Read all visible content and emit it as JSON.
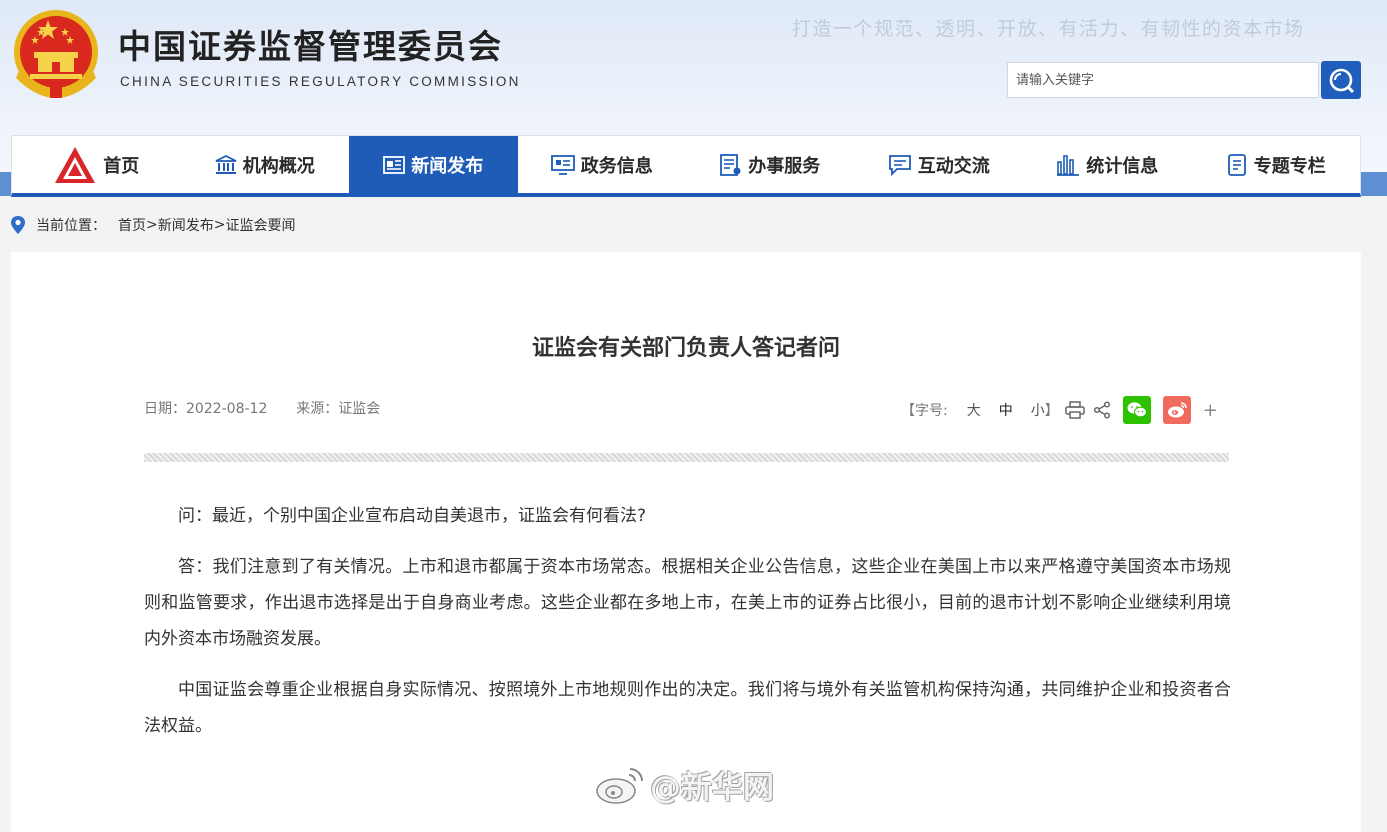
{
  "header": {
    "title_cn": "中国证券监督管理委员会",
    "title_en": "CHINA SECURITIES REGULATORY COMMISSION",
    "slogan": "打造一个规范、透明、开放、有活力、有韧性的资本市场",
    "search_placeholder": "请输入关键字"
  },
  "nav": [
    {
      "label": "首页",
      "icon": "csrc-logo-icon"
    },
    {
      "label": "机构概况",
      "icon": "institution-icon"
    },
    {
      "label": "新闻发布",
      "icon": "news-icon",
      "active": true
    },
    {
      "label": "政务信息",
      "icon": "monitor-icon"
    },
    {
      "label": "办事服务",
      "icon": "service-icon"
    },
    {
      "label": "互动交流",
      "icon": "chat-icon"
    },
    {
      "label": "统计信息",
      "icon": "stats-icon"
    },
    {
      "label": "专题专栏",
      "icon": "topic-icon"
    }
  ],
  "breadcrumb": {
    "prefix": "当前位置：",
    "items": [
      "首页",
      "新闻发布",
      "证监会要闻"
    ],
    "sep": ">"
  },
  "article": {
    "title": "证监会有关部门负责人答记者问",
    "date_label": "日期：",
    "date": "2022-08-12",
    "source_label": "来源：",
    "source": "证监会",
    "font_size_label": "【字号:",
    "font_sizes": [
      "大",
      "中",
      "小"
    ],
    "font_size_close": "】",
    "more": "+",
    "paragraphs": [
      "问：最近，个别中国企业宣布启动自美退市，证监会有何看法?",
      "答：我们注意到了有关情况。上市和退市都属于资本市场常态。根据相关企业公告信息，这些企业在美国上市以来严格遵守美国资本市场规则和监管要求，作出退市选择是出于自身商业考虑。这些企业都在多地上市，在美上市的证券占比很小，目前的退市计划不影响企业继续利用境内外资本市场融资发展。",
      "中国证监会尊重企业根据自身实际情况、按照境外上市地规则作出的决定。我们将与境外有关监管机构保持沟通，共同维护企业和投资者合法权益。"
    ]
  },
  "watermark": "@新华网",
  "colors": {
    "primary": "#1e5cb8",
    "band": "#5e8fd3",
    "wechat": "#2dc100",
    "weibo": "#f06a5e"
  }
}
